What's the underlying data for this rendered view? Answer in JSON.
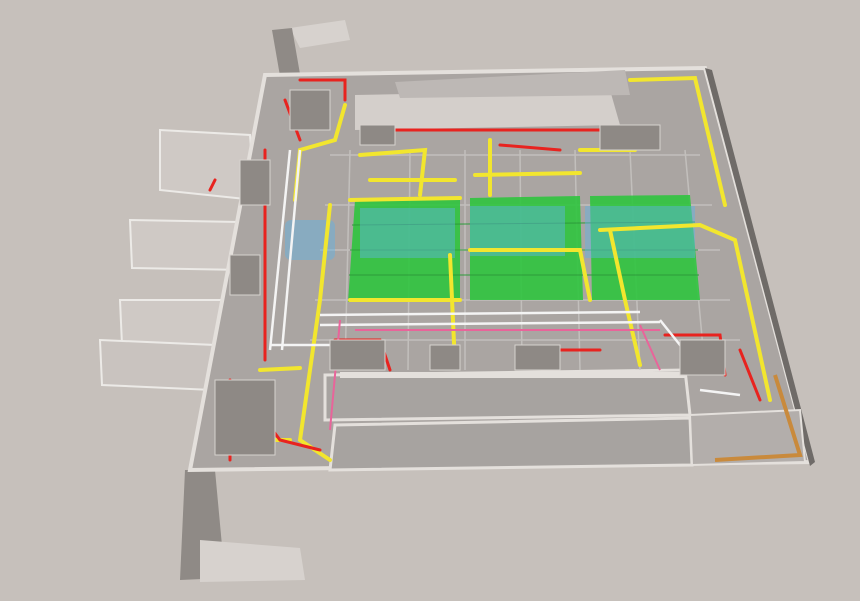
{
  "scene": {
    "description_free": true,
    "colors": {
      "background": "#c6c0bb",
      "floor": "#aaa5a2",
      "wall": "#e4e0dc",
      "wall_shadow": "#8f8a86",
      "equipment": "#a9a4a0",
      "pipe_yellow": "#f2e62e",
      "pipe_red": "#e8231f",
      "pipe_white": "#f4f4f4",
      "pipe_pink": "#e9649a",
      "pipe_orange": "#c98a3c",
      "cable_tray_green": "#2fc53f",
      "watermark_blue": "#5fb4e6"
    },
    "room_tags": [
      "",
      "",
      "",
      "",
      ""
    ]
  }
}
